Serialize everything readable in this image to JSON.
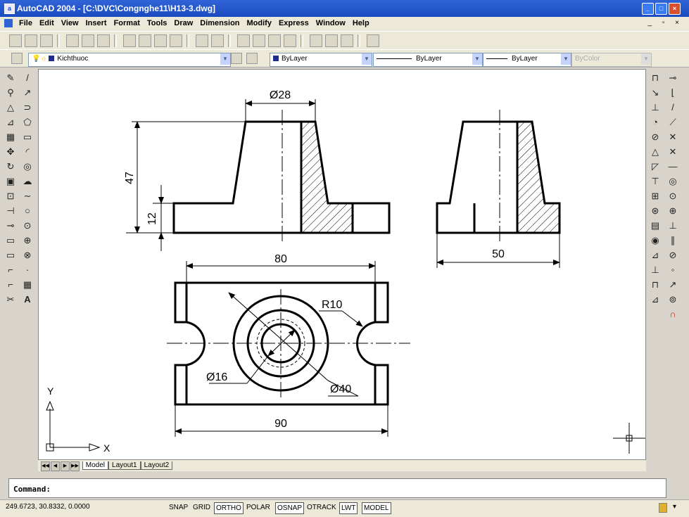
{
  "window": {
    "title": "AutoCAD 2004 - [C:\\DVC\\Congnghe11\\H13-3.dwg]",
    "controls": [
      "_",
      "□",
      "×"
    ]
  },
  "menu": [
    "File",
    "Edit",
    "View",
    "Insert",
    "Format",
    "Tools",
    "Draw",
    "Dimension",
    "Modify",
    "Express",
    "Window",
    "Help"
  ],
  "layer": {
    "name": "Kichthuoc",
    "color": "#1f2d8a"
  },
  "properties": {
    "color": "ByLayer",
    "linetype": "ByLayer",
    "lineweight": "ByLayer",
    "plotstyle": "ByColor"
  },
  "left_toolbar": {
    "modify": [
      "✎",
      "⚲",
      "△",
      "⊿",
      "▦",
      "✥",
      "↻",
      "▣",
      "⊡",
      "⊣",
      "⊸",
      "▭",
      "▭",
      "⌐",
      "⌐",
      "✂"
    ],
    "draw": [
      "/",
      "↗",
      "⊃",
      "⬠",
      "▭",
      "◜",
      "◎",
      "☁",
      "∼",
      "○",
      "⊙",
      "⊕",
      "⊗",
      "·",
      "▦",
      "A"
    ]
  },
  "right_toolbar": {
    "col1": [
      "⊓",
      "↘",
      "⊥",
      "◔",
      "⊘",
      "△",
      "◸",
      "⊤",
      "⊞",
      "⊛",
      "▤",
      "◉",
      "⊿",
      "⊥",
      "⊓",
      "⊿"
    ],
    "col2": [
      "⊸",
      "⌊",
      "/",
      "⟋",
      "✕",
      "✕",
      "—",
      "◎",
      "⊙",
      "⊕",
      "⊥",
      "∥",
      "⊘",
      "◦",
      "↗",
      "⊚",
      "∩"
    ]
  },
  "drawing": {
    "dims": {
      "top_width": "Ø28",
      "height_total": "47",
      "base_height": "12",
      "side_width": "50",
      "plan_top_width": "80",
      "plan_bottom_width": "90",
      "radius": "R10",
      "diam_small": "Ø16",
      "diam_large": "Ø40"
    },
    "ucs": {
      "x": "X",
      "y": "Y"
    }
  },
  "tabs": {
    "nav": [
      "◀◀",
      "◀",
      "▶",
      "▶▶"
    ],
    "items": [
      "Model",
      "Layout1",
      "Layout2"
    ],
    "active": "Model"
  },
  "command": {
    "prompt": "Command:"
  },
  "status": {
    "coords": "249.6723, 30.8332, 0.0000",
    "buttons": [
      "SNAP",
      "GRID",
      "ORTHO",
      "POLAR",
      "OSNAP",
      "OTRACK",
      "LWT",
      "MODEL"
    ],
    "on": [
      "ORTHO",
      "OSNAP",
      "LWT",
      "MODEL"
    ]
  }
}
